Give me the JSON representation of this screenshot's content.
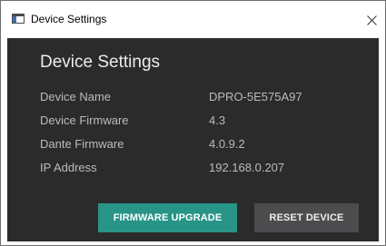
{
  "window": {
    "title": "Device Settings",
    "close_glyph": "×",
    "app_icon": "window-app-icon",
    "close_icon": "close-icon"
  },
  "dialog": {
    "heading": "Device Settings",
    "rows": [
      {
        "label": "Device Name",
        "value": "DPRO-5E575A97"
      },
      {
        "label": "Device Firmware",
        "value": "4.3"
      },
      {
        "label": "Dante Firmware",
        "value": "4.0.9.2"
      },
      {
        "label": "IP Address",
        "value": "192.168.0.207"
      }
    ],
    "buttons": {
      "firmware_upgrade": "FIRMWARE UPGRADE",
      "reset_device": "RESET DEVICE"
    }
  },
  "colors": {
    "panel_background": "#2b2b2c",
    "primary_button": "#289488",
    "secondary_button": "#4c4c4e",
    "text": "#b9bbbd"
  }
}
